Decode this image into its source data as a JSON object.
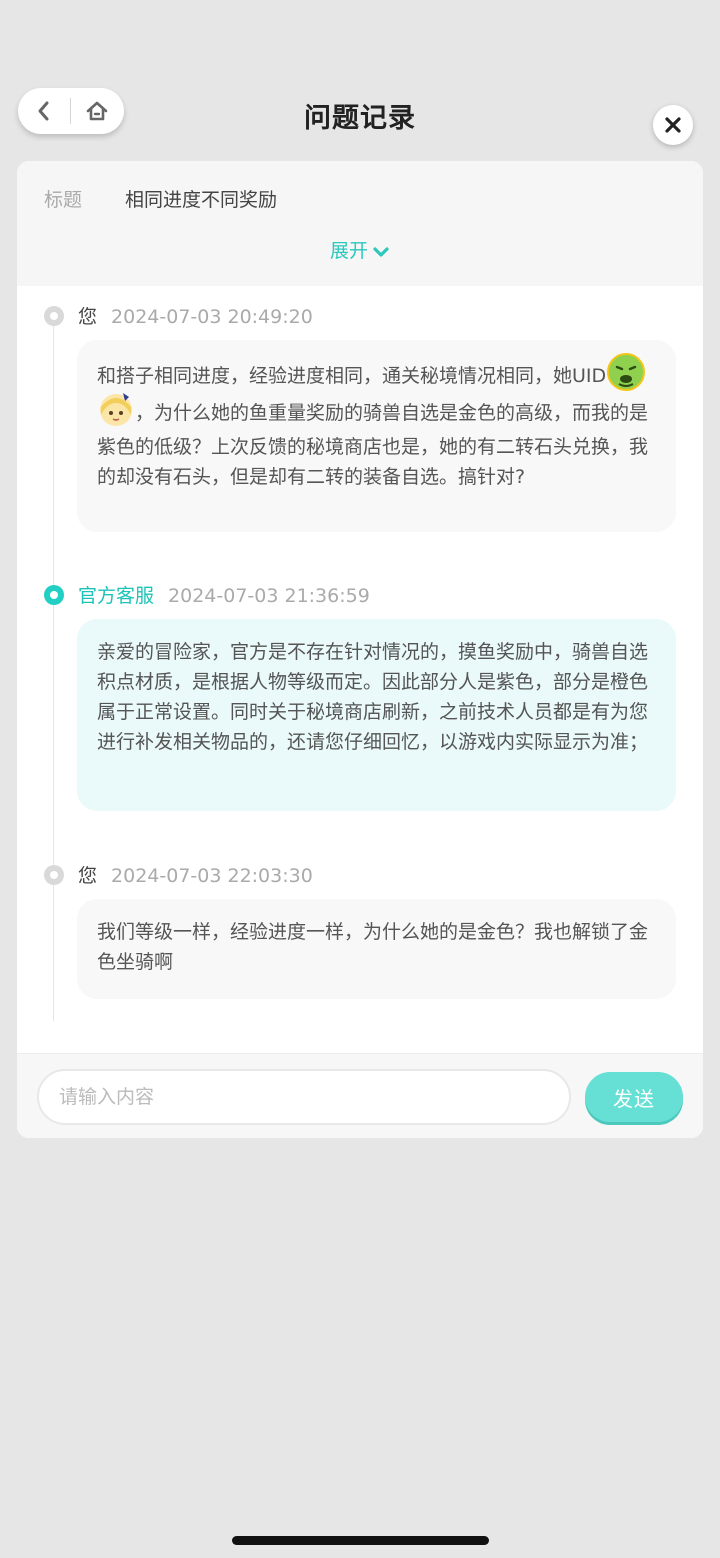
{
  "header": {
    "title": "问题记录",
    "back_icon": "chevron-left-icon",
    "home_icon": "home-icon",
    "close_icon": "close-icon"
  },
  "ticket": {
    "title_label": "标题",
    "title_value": "相同进度不同奖励",
    "expand_label": "展开"
  },
  "messages": [
    {
      "sender": "您",
      "role": "user",
      "time": "2024-07-03 20:49:20",
      "text_before_emoji": "和搭子相同进度，经验进度相同，通关秘境情况相同，她UID",
      "emojis": [
        "sick-face-emoji",
        "anime-girl-emoji"
      ],
      "text_after_emoji": "，为什么她的鱼重量奖励的骑兽自选是金色的高级，而我的是紫色的低级？上次反馈的秘境商店也是，她的有二转石头兑换，我的却没有石头，但是却有二转的装备自选。搞针对?"
    },
    {
      "sender": "官方客服",
      "role": "official",
      "time": "2024-07-03 21:36:59",
      "text": "亲爱的冒险家，官方是不存在针对情况的，摸鱼奖励中，骑兽自选积点材质，是根据人物等级而定。因此部分人是紫色，部分是橙色属于正常设置。同时关于秘境商店刷新，之前技术人员都是有为您进行补发相关物品的，还请您仔细回忆，以游戏内实际显示为准；"
    },
    {
      "sender": "您",
      "role": "user",
      "time": "2024-07-03 22:03:30",
      "text": "我们等级一样，经验进度一样，为什么她的是金色？我也解锁了金色坐骑啊"
    }
  ],
  "composer": {
    "placeholder": "请输入内容",
    "value": "",
    "send_label": "发送"
  },
  "colors": {
    "accent": "#22cfc3",
    "official_bubble": "#eaf9f9",
    "user_bubble": "#f8f8f8",
    "send_button": "#66e0d5",
    "background": "#e6e6e6"
  }
}
